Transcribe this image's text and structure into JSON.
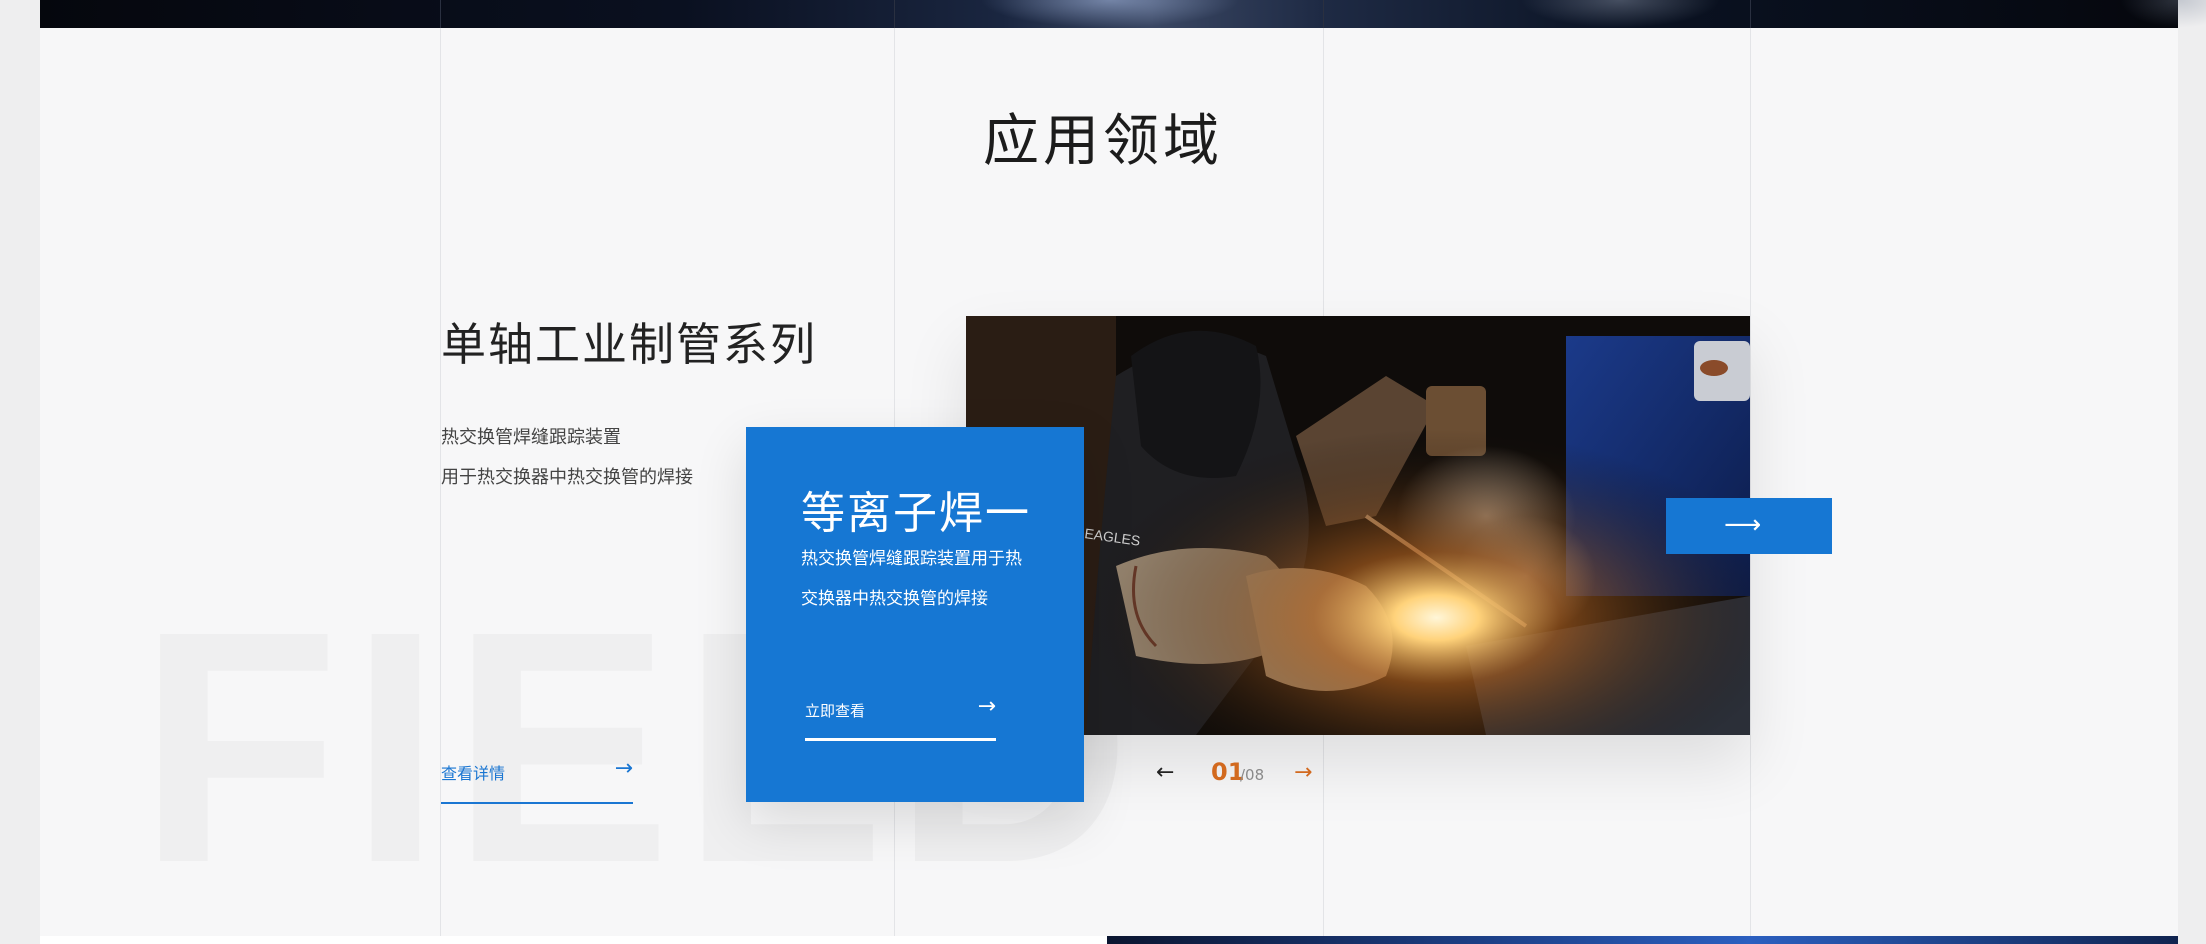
{
  "section": {
    "title": "应用领域",
    "watermark": "FIELD"
  },
  "series": {
    "title": "单轴工业制管系列",
    "desc_line_1": "热交换管焊缝跟踪装置",
    "desc_line_2": "用于热交换器中热交换管的焊接",
    "details_label": "查看详情",
    "details_icon": "arrow-right-icon"
  },
  "card": {
    "title": "等离子焊一",
    "desc_line_1": "热交换管焊缝跟踪装置用于热",
    "desc_line_2": "交换器中热交换管的焊接",
    "view_label": "立即查看",
    "view_icon": "arrow-right-icon",
    "color": "#1677d3"
  },
  "photo": {
    "subject": "welding-photo",
    "glove_text": "EAGLES"
  },
  "pager": {
    "current": "01",
    "total": "/08",
    "prev_icon": "arrow-left-icon",
    "next_icon": "arrow-right-icon",
    "accent_color": "#d2691e"
  },
  "next_button": {
    "icon": "long-arrow-right-icon"
  }
}
